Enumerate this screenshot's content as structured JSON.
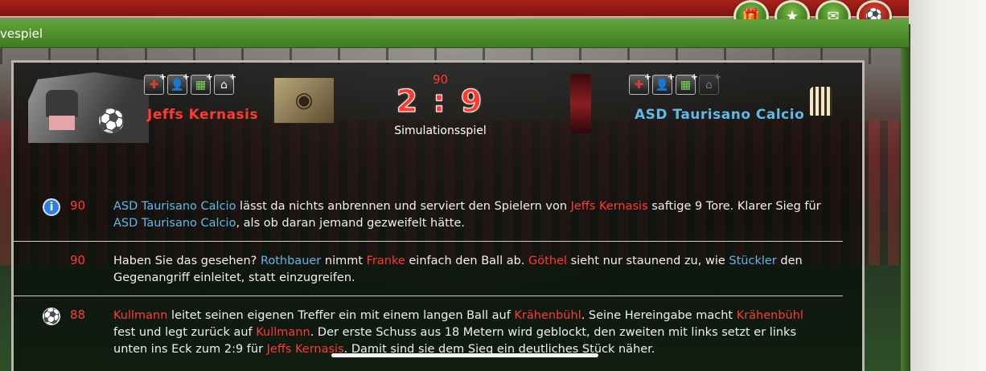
{
  "header": {
    "title": "vespiel"
  },
  "top_icons": [
    "gift-icon",
    "star-icon",
    "mail-icon",
    "football-icon"
  ],
  "match": {
    "minute": "90",
    "score": "2 : 9",
    "mode": "Simulationsspiel",
    "home_team": "Jeffs Kernasis",
    "away_team": "ASD Taurisano Calcio"
  },
  "events": [
    {
      "icon": "info-icon",
      "minute": "90",
      "parts": [
        {
          "t": "ASD Taurisano Calcio",
          "c": "away"
        },
        {
          "t": " lässt da nichts anbrennen und serviert den Spielern von ",
          "c": ""
        },
        {
          "t": "Jeffs Kernasis",
          "c": "home"
        },
        {
          "t": " saftige 9 Tore. Klarer Sieg für ",
          "c": ""
        },
        {
          "t": "ASD Taurisano Calcio",
          "c": "away"
        },
        {
          "t": ", als ob daran jemand gezweifelt hätte.",
          "c": ""
        }
      ]
    },
    {
      "icon": "",
      "minute": "90",
      "parts": [
        {
          "t": "Haben Sie das gesehen? ",
          "c": ""
        },
        {
          "t": "Rothbauer",
          "c": "away"
        },
        {
          "t": " nimmt ",
          "c": ""
        },
        {
          "t": "Franke",
          "c": "home"
        },
        {
          "t": " einfach den Ball ab. ",
          "c": ""
        },
        {
          "t": "Göthel",
          "c": "home"
        },
        {
          "t": " sieht nur staunend zu, wie ",
          "c": ""
        },
        {
          "t": "Stückler",
          "c": "away"
        },
        {
          "t": " den Gegenangriff einleitet, statt einzugreifen.",
          "c": ""
        }
      ]
    },
    {
      "icon": "ball-icon",
      "minute": "88",
      "parts": [
        {
          "t": "Kullmann",
          "c": "home"
        },
        {
          "t": " leitet seinen eigenen Treffer ein mit einem langen Ball auf ",
          "c": ""
        },
        {
          "t": "Krähenbühl",
          "c": "home"
        },
        {
          "t": ". Seine Hereingabe macht ",
          "c": ""
        },
        {
          "t": "Krähenbühl",
          "c": "home"
        },
        {
          "t": " fest und legt zurück auf ",
          "c": ""
        },
        {
          "t": "Kullmann",
          "c": "home"
        },
        {
          "t": ". Der erste Schuss aus 18 Metern wird geblockt, den zweiten mit links setzt er links unten ins Eck zum 2:9 für ",
          "c": ""
        },
        {
          "t": "Jeffs Kernasis",
          "c": "home"
        },
        {
          "t": ". Damit sind sie dem Sieg ein deutliches Stück näher.",
          "c": ""
        }
      ]
    }
  ]
}
